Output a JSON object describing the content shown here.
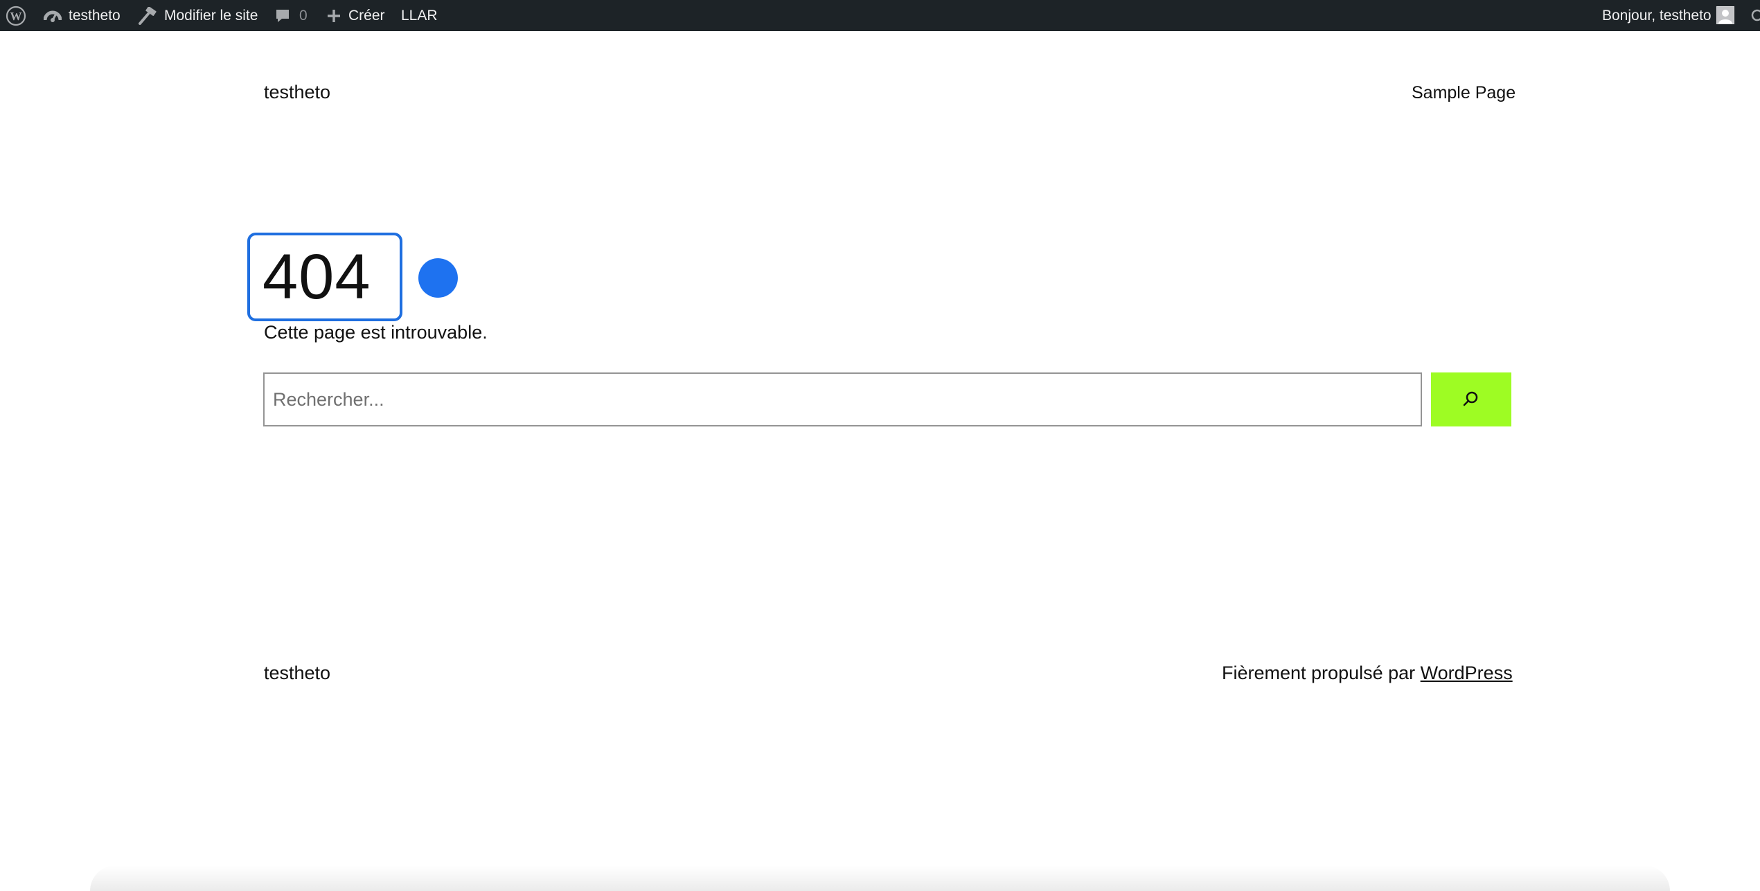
{
  "admin_bar": {
    "logo_icon": "wordpress-logo-icon",
    "site_name": "testheto",
    "site_icon": "dashboard-icon",
    "edit_site_label": "Modifier le site",
    "edit_site_icon": "hammer-icon",
    "comments_count": "0",
    "comments_icon": "comment-icon",
    "new_label": "Créer",
    "new_icon": "plus-icon",
    "llar_label": "LLAR",
    "greeting": "Bonjour, testheto",
    "account_icon": "avatar",
    "search_icon": "search-icon",
    "background_color": "#1d2327"
  },
  "header": {
    "site_title": "testheto",
    "nav_items": [
      {
        "label": "Sample Page"
      }
    ]
  },
  "main": {
    "heading": "404",
    "message": "Cette page est introuvable.",
    "focus_color": "#1f6fe0",
    "dot_color": "#1e72f0",
    "search": {
      "value": "",
      "placeholder": "Rechercher...",
      "button_icon": "search-icon",
      "button_color": "#9efc23"
    }
  },
  "footer": {
    "site_title": "testheto",
    "credit_prefix": "Fièrement propulsé par",
    "credit_link": "WordPress"
  }
}
